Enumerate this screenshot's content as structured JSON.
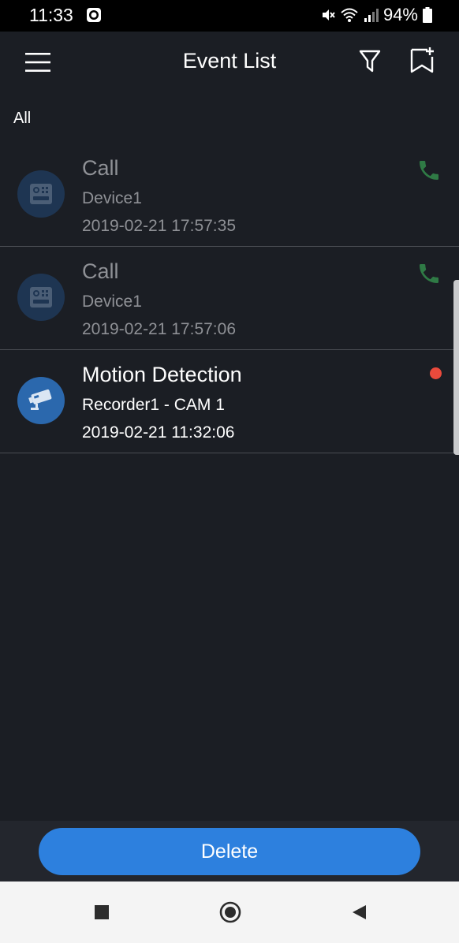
{
  "status_bar": {
    "time": "11:33",
    "battery": "94%"
  },
  "header": {
    "title": "Event List",
    "icons": [
      "menu-icon",
      "filter-icon",
      "bookmark-add-icon"
    ]
  },
  "filter": {
    "label": "All"
  },
  "events": [
    {
      "title": "Call",
      "device": "Device1",
      "time": "2019-02-21 17:57:35",
      "icon": "intercom-icon",
      "status_icon": "phone-icon",
      "read": true
    },
    {
      "title": "Call",
      "device": "Device1",
      "time": "2019-02-21 17:57:06",
      "icon": "intercom-icon",
      "status_icon": "phone-icon",
      "read": true
    },
    {
      "title": "Motion Detection",
      "device": "Recorder1 - CAM 1",
      "time": "2019-02-21 11:32:06",
      "icon": "camera-icon",
      "status_icon": "unread-dot",
      "read": false
    }
  ],
  "footer": {
    "delete_label": "Delete"
  },
  "colors": {
    "background": "#1b1e24",
    "accent": "#2d80de",
    "call_green": "#2f7a45",
    "unread_red": "#ea4a3c"
  }
}
